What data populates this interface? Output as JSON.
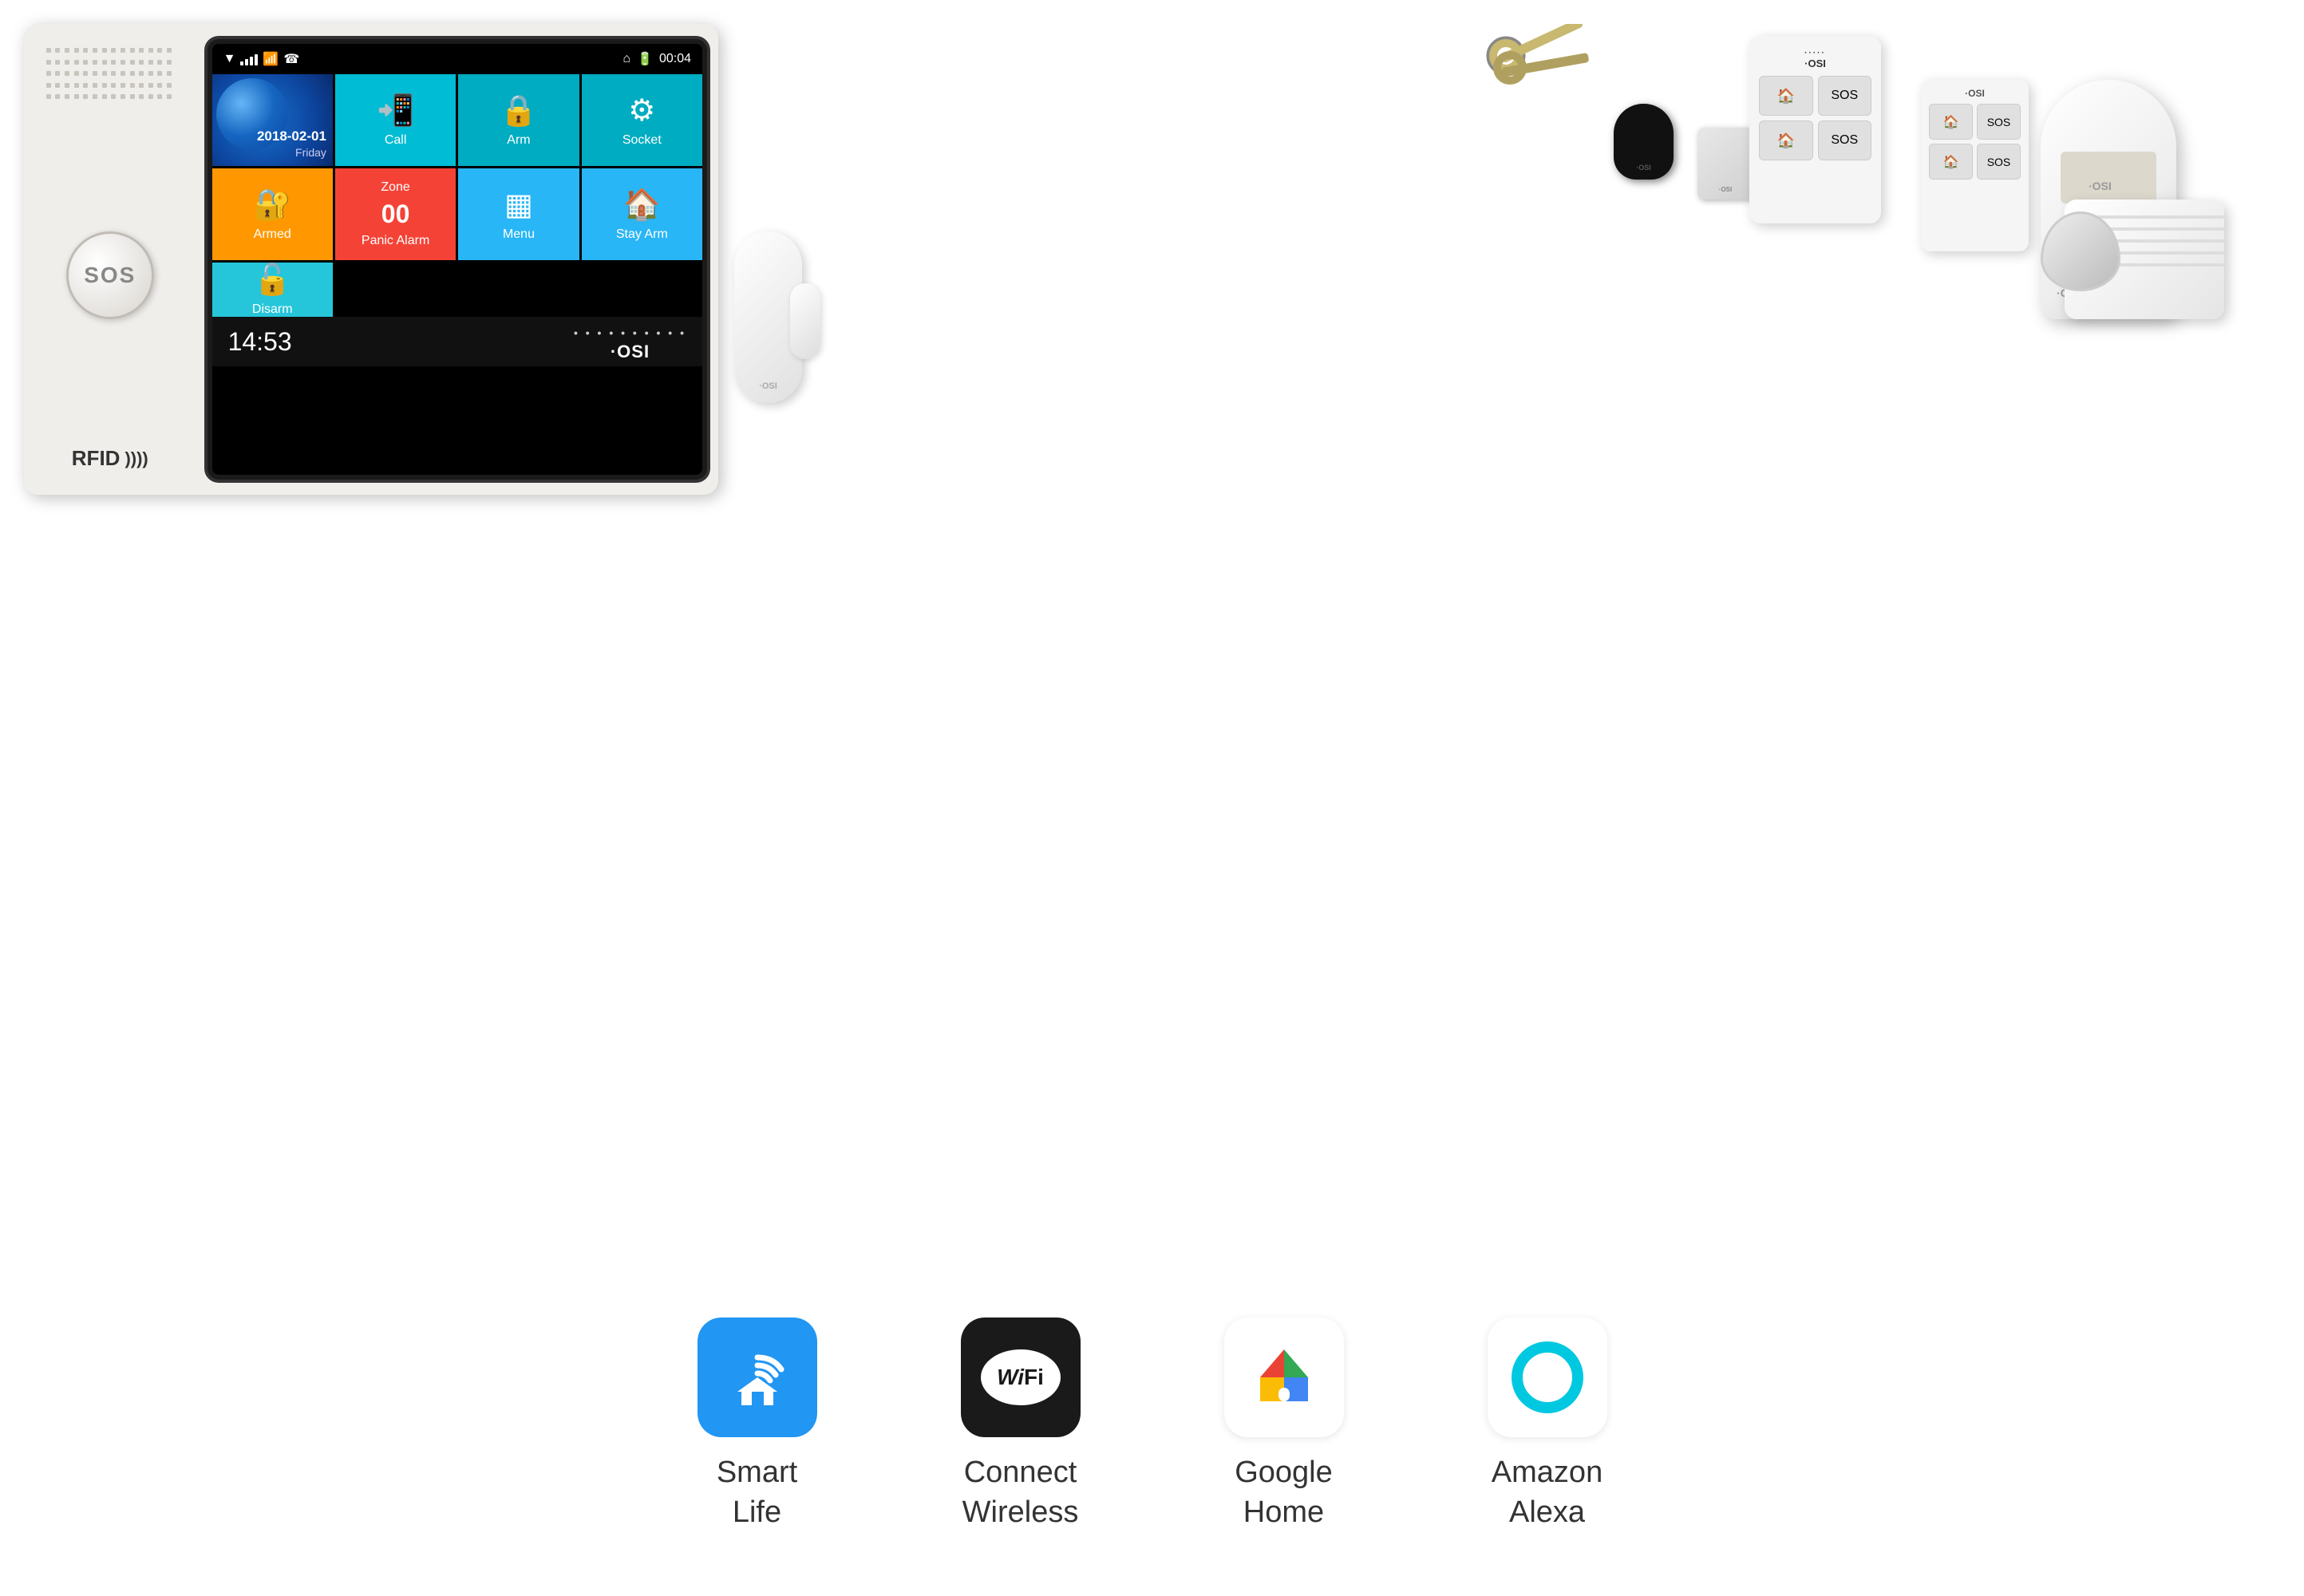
{
  "alarm_unit": {
    "sos_label": "SOS",
    "rfid_label": "RFID",
    "status_bar": {
      "time": "00:04",
      "key_icon": "⌂"
    },
    "screen": {
      "date": "2018-02-01",
      "day": "Friday",
      "tiles": [
        {
          "id": "call",
          "label": "Call",
          "icon": "📞"
        },
        {
          "id": "arm",
          "label": "Arm",
          "icon": "🔒"
        },
        {
          "id": "socket",
          "label": "Socket",
          "icon": "⚙"
        },
        {
          "id": "armed",
          "label": "Armed",
          "icon": "🔒"
        },
        {
          "id": "panic",
          "label": "Panic Alarm",
          "zone": "Zone 00"
        },
        {
          "id": "menu",
          "label": "Menu",
          "icon": "▦"
        },
        {
          "id": "stay",
          "label": "Stay Arm",
          "icon": "🏠"
        },
        {
          "id": "disarm",
          "label": "Disarm",
          "icon": "🔓"
        }
      ],
      "time_display": "14:53",
      "osi_logo": "·OSI"
    }
  },
  "features": [
    {
      "id": "smart-life",
      "label": "Smart\nLife",
      "icon_type": "smart-life"
    },
    {
      "id": "wifi",
      "label": "Connect\nWireless",
      "icon_type": "wifi"
    },
    {
      "id": "google-home",
      "label": "Google\nHome",
      "icon_type": "google-home"
    },
    {
      "id": "alexa",
      "label": "Amazon\nAlexa",
      "icon_type": "alexa"
    }
  ],
  "accessories": {
    "door_sensor_brand": "·OSI",
    "pir_brand": "·OSI",
    "siren_brand": "·OSI",
    "remote_brand": "OSI"
  }
}
